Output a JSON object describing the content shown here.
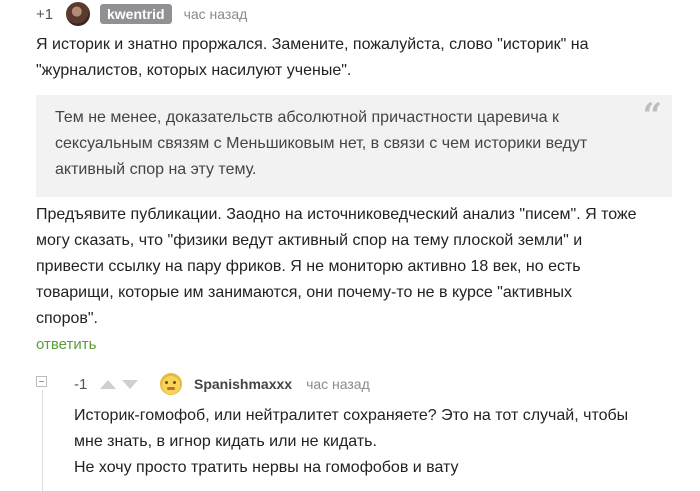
{
  "comment": {
    "rating": "+1",
    "author": "kwentrid",
    "time": "час назад",
    "lines_top": [
      "Я историк и знатно проржался. Замените, пожалуйста, слово \"историк\" на",
      "\"журналистов, которых насилуют ученые\"."
    ],
    "quote_icon": "quote-icon",
    "quote_lines": [
      "Тем не менее, доказательств абсолютной причастности царевича к",
      "сексуальным связям с Меньшиковым нет, в связи с чем историки ведут",
      "активный спор на эту тему."
    ],
    "lines_bottom": [
      "Предъявите публикации. Заодно на источниковедческий анализ \"писем\". Я тоже",
      "могу сказать, что \"физики ведут активный спор на тему плоской земли\" и",
      "привести ссылку на пару фриков. Я не мониторю активно 18 век, но есть",
      "товарищи, которые им занимаются, они почему-то не в курсе \"активных",
      "споров\"."
    ],
    "reply_label": "ответить"
  },
  "reply_comment": {
    "rating": "-1",
    "author": "Spanishmaxxx",
    "time": "час назад",
    "lines": [
      "Историк-гомофоб, или нейтралитет сохраняете? Это на тот случай, чтобы",
      "мне знать, в игнор кидать или не кидать.",
      "Не хочу просто тратить нервы на гомофобов и вату"
    ]
  },
  "colors": {
    "reply_link": "#5a9c3a",
    "author_badge": "#8f9195",
    "quote_background": "#f2f2f2"
  }
}
